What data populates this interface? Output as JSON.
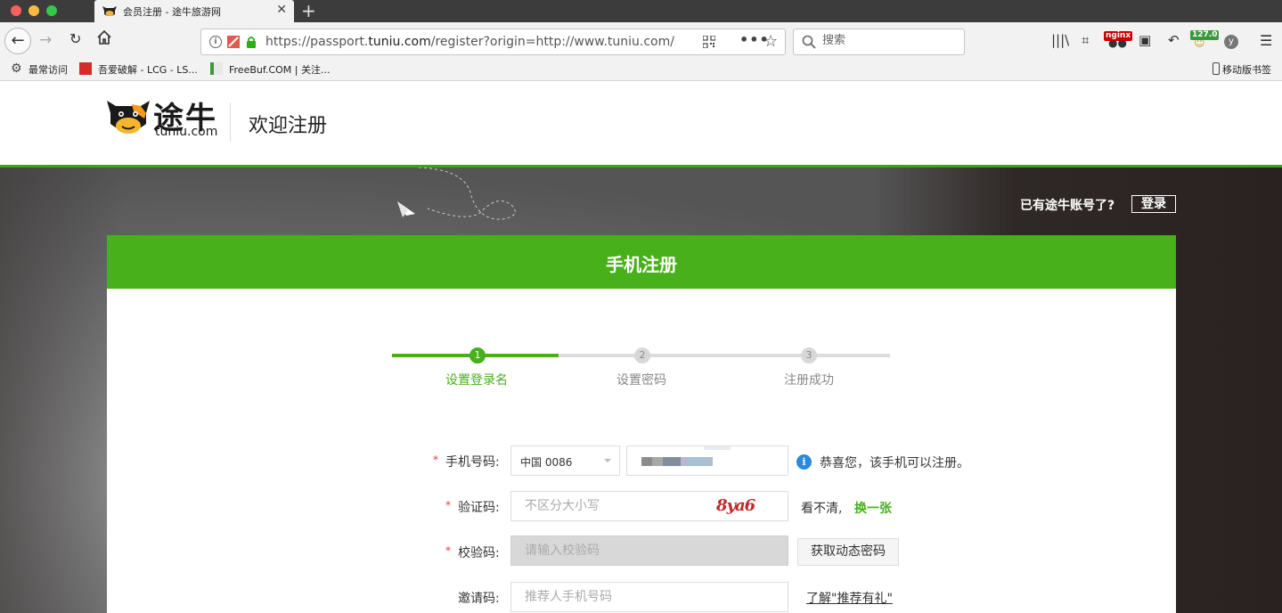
{
  "browser": {
    "tab_title": "会员注册 - 途牛旅游网",
    "url_prefix": "https://passport.",
    "url_domain": "tuniu.com",
    "url_rest": "/register?origin=http://www.tuniu.com/ssoCo",
    "search_placeholder": "搜索",
    "ext_nginx": "nginx",
    "ext_ip": "127.0",
    "bookmarks": [
      "最常访问",
      "吾爱破解 - LCG - LS...",
      "FreeBuf.COM | 关注..."
    ],
    "mobile_bookmarks": "移动版书签"
  },
  "header": {
    "logo_cn": "途牛",
    "logo_en": "tuniu.com",
    "title": "欢迎注册"
  },
  "hero": {
    "login_prompt": "已有途牛账号了?",
    "login_button": "登录"
  },
  "card": {
    "title": "手机注册",
    "steps": [
      {
        "num": "1",
        "label": "设置登录名"
      },
      {
        "num": "2",
        "label": "设置密码"
      },
      {
        "num": "3",
        "label": "注册成功"
      }
    ],
    "current_step": 1
  },
  "form": {
    "phone_label": "手机号码:",
    "country_value": "中国 0086",
    "phone_tip": "恭喜您，该手机可以注册。",
    "captcha_label": "验证码:",
    "captcha_placeholder": "不区分大小写",
    "captcha_text": "8ya6",
    "captcha_unclear": "看不清,",
    "captcha_change": "换一张",
    "verify_label": "校验码:",
    "verify_placeholder": "请输入校验码",
    "get_code_button": "获取动态密码",
    "invite_label": "邀请码:",
    "invite_placeholder": "推荐人手机号码",
    "invite_link": "了解\"推荐有礼\""
  },
  "colors": {
    "brand_green": "#47b01a",
    "required_red": "#e4393c",
    "info_blue": "#2a8ae0"
  }
}
